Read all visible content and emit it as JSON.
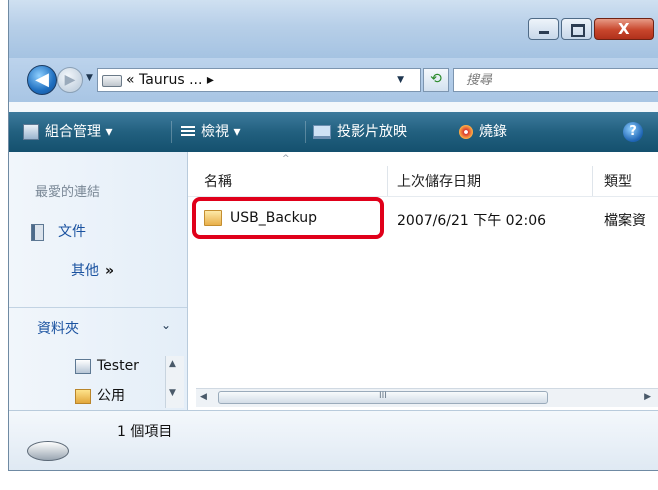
{
  "window": {
    "close_label": "X"
  },
  "nav": {
    "back_glyph": "◀",
    "forward_glyph": "▶",
    "history_dropdown_glyph": "▼"
  },
  "address": {
    "path_text": "« Taurus ... ▸",
    "dropdown_glyph": "▼",
    "refresh_glyph": "⟲"
  },
  "search": {
    "placeholder": "搜尋"
  },
  "commands": {
    "organize": "組合管理 ▾",
    "views": "檢視 ▾",
    "slideshow": "投影片放映",
    "burn": "燒錄",
    "help_glyph": "?"
  },
  "sidebar": {
    "favorites_title": "最愛的連結",
    "documents": "文件",
    "more": "其他",
    "more_glyph": "»",
    "folders_header": "資料夾",
    "folders_chevron": "⌄",
    "tree": [
      {
        "label": "Tester"
      },
      {
        "label": "公用"
      }
    ]
  },
  "filelist": {
    "columns": [
      "名稱",
      "上次儲存日期",
      "類型"
    ],
    "sort_indicator": "^",
    "rows": [
      {
        "name": "USB_Backup",
        "date": "2007/6/21 下午 02:06",
        "type": "檔案資"
      }
    ],
    "scroll_grip": "III"
  },
  "details": {
    "item_count": "1 個項目"
  },
  "colors": {
    "highlight": "#e0001a",
    "command_bar": "#22607f",
    "link_text": "#1a52a0"
  }
}
